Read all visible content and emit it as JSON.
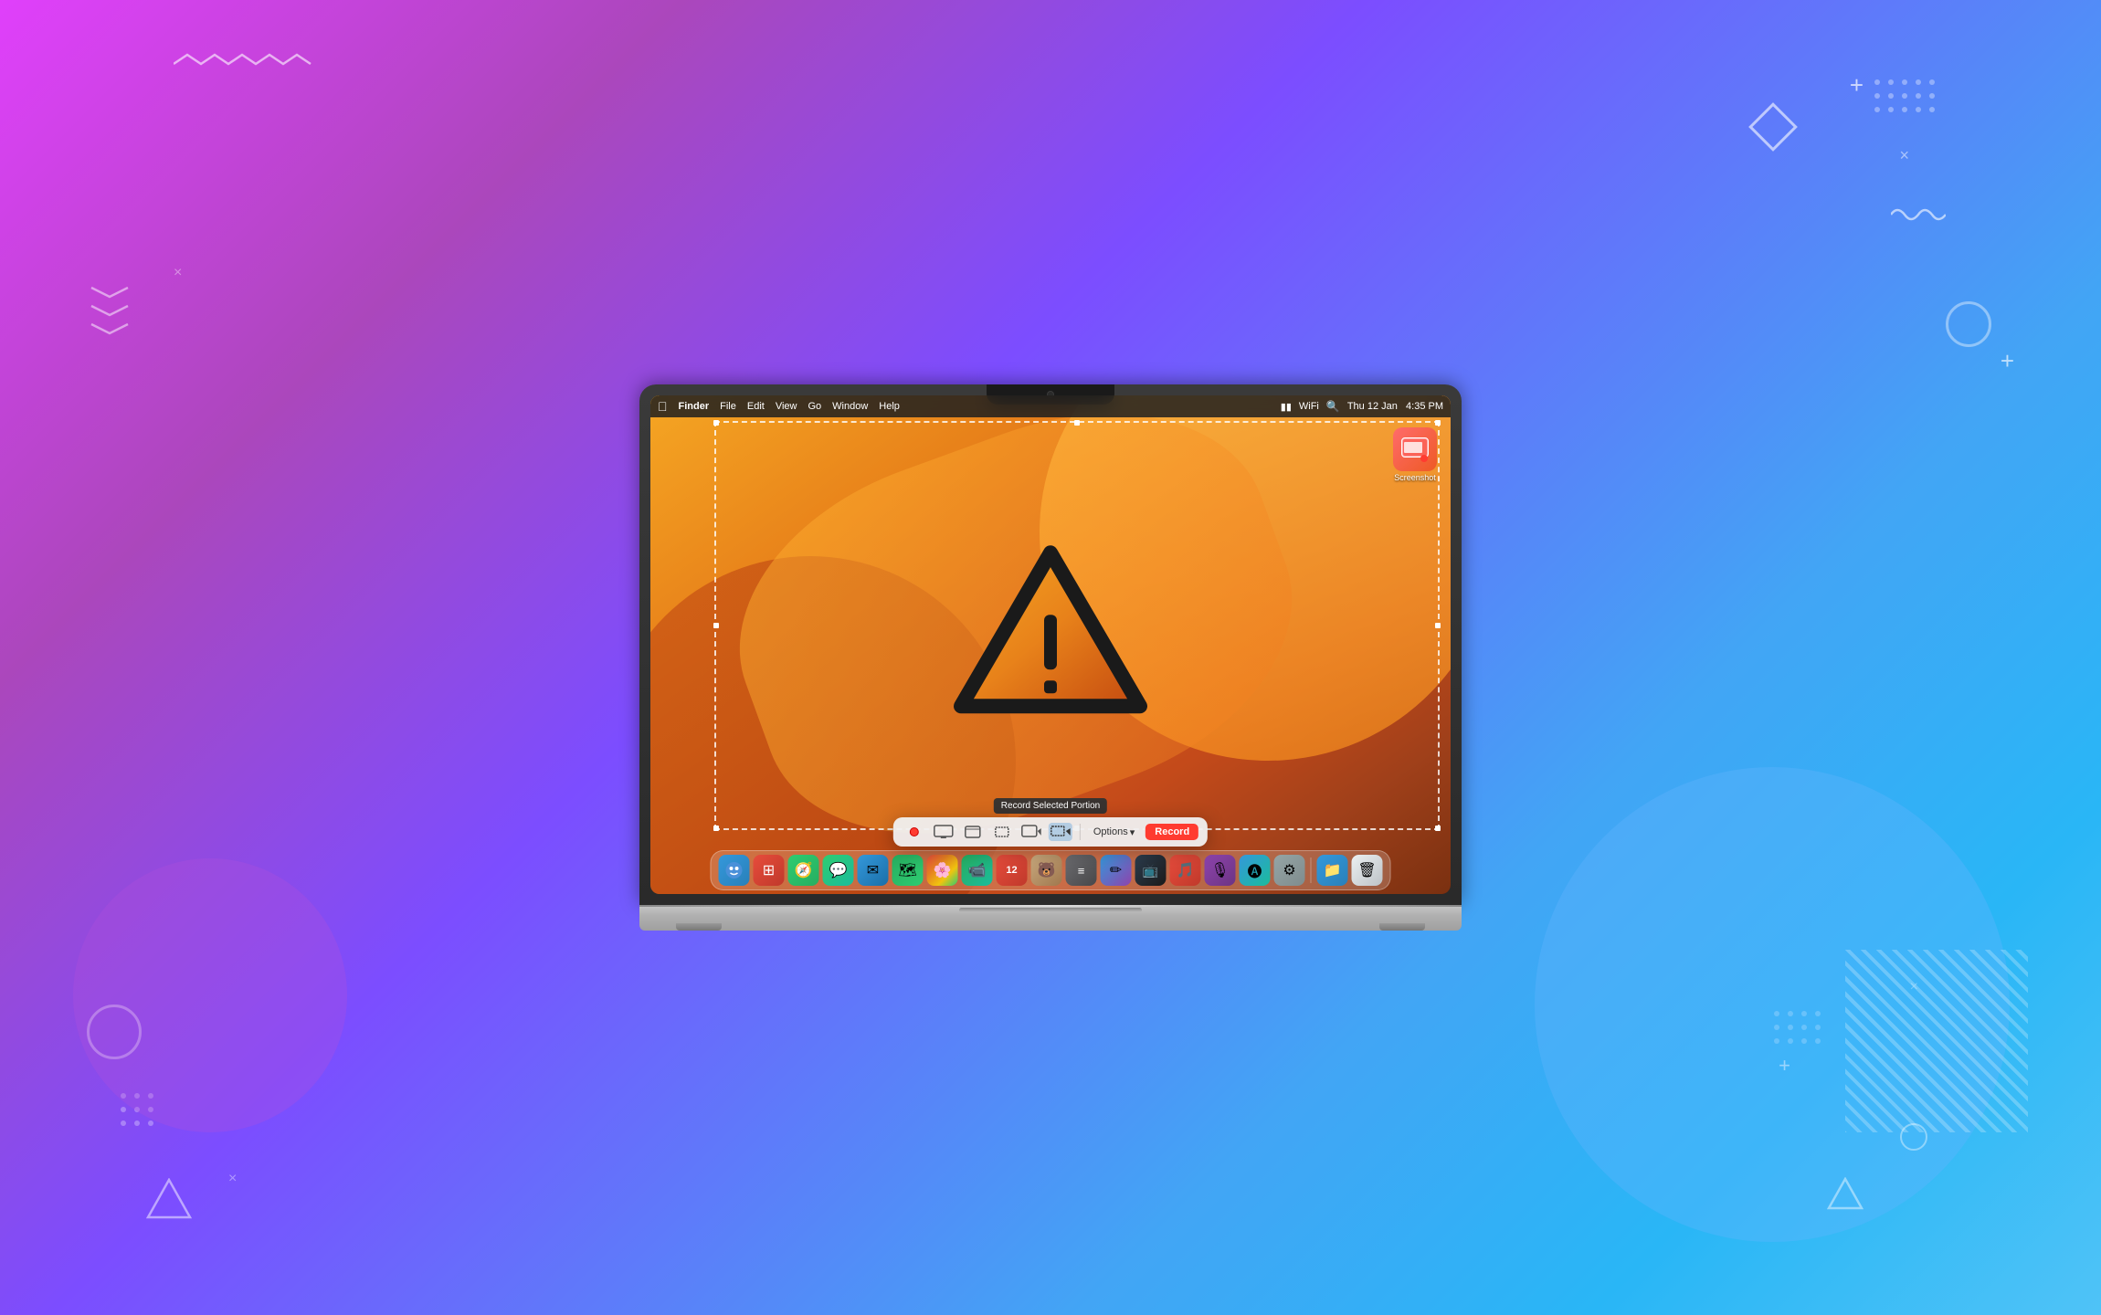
{
  "background": {
    "gradient_start": "#e040fb",
    "gradient_end": "#29b6f6"
  },
  "decorations": {
    "zigzag_top_left": "∿∿∿∿∿",
    "chevrons_left": "⋀\n⋀\n⋀",
    "plus_top_right": "+",
    "plus_mid_right": "+",
    "wavy_right": "〜〜〜",
    "x_marks": [
      "×",
      "×",
      "×",
      "×"
    ],
    "cross_mark": "+"
  },
  "macbook": {
    "screen": {
      "wallpaper": "macOS Ventura orange gradient",
      "menubar": {
        "apple_icon": "⌘",
        "items": [
          "Finder",
          "File",
          "Edit",
          "View",
          "Go",
          "Window",
          "Help"
        ],
        "right_items": [
          "🔋",
          "📶",
          "🔍",
          "Thu 12 Jan",
          "4:35 PM"
        ]
      },
      "desktop_icon": {
        "name": "Screenshot",
        "label": "Screenshot"
      },
      "warning_icon": "⚠",
      "screenshot_selection": {
        "visible": true
      },
      "tooltip": {
        "text": "Record Selected Portion"
      },
      "toolbar": {
        "buttons": [
          {
            "id": "record-dot",
            "icon": "●",
            "label": "Record",
            "type": "dot"
          },
          {
            "id": "capture-screen",
            "icon": "▭",
            "label": "Capture Entire Screen"
          },
          {
            "id": "capture-window",
            "icon": "▭",
            "label": "Capture Selected Window"
          },
          {
            "id": "capture-portion",
            "icon": "▭",
            "label": "Capture Selected Portion"
          },
          {
            "id": "record-screen",
            "icon": "▭",
            "label": "Record Entire Screen"
          },
          {
            "id": "record-portion",
            "icon": "▭",
            "label": "Record Selected Portion",
            "active": true
          }
        ],
        "options_label": "Options",
        "options_chevron": "▾",
        "record_label": "Record"
      },
      "dock": {
        "icons": [
          {
            "id": "finder",
            "emoji": "🔵",
            "label": "Finder",
            "class": "dock-finder"
          },
          {
            "id": "launchpad",
            "emoji": "🔴",
            "label": "Launchpad",
            "class": "dock-launchpad"
          },
          {
            "id": "safari",
            "emoji": "🧭",
            "label": "Safari",
            "class": "dock-safari"
          },
          {
            "id": "messages",
            "emoji": "💬",
            "label": "Messages",
            "class": "dock-messages"
          },
          {
            "id": "mail",
            "emoji": "✉",
            "label": "Mail",
            "class": "dock-mail"
          },
          {
            "id": "maps",
            "emoji": "🗺",
            "label": "Maps",
            "class": "dock-maps"
          },
          {
            "id": "photos",
            "emoji": "🖼",
            "label": "Photos",
            "class": "dock-photos"
          },
          {
            "id": "facetime",
            "emoji": "📹",
            "label": "FaceTime",
            "class": "dock-facetime"
          },
          {
            "id": "calendar",
            "emoji": "📅",
            "label": "Calendar",
            "class": "dock-calendar"
          },
          {
            "id": "bear",
            "emoji": "🐻",
            "label": "Bear",
            "class": "dock-bear"
          },
          {
            "id": "reminders",
            "emoji": "📝",
            "label": "Reminders",
            "class": "dock-reminders"
          },
          {
            "id": "freeform",
            "emoji": "✏",
            "label": "Freeform",
            "class": "dock-freeform"
          },
          {
            "id": "appletv",
            "emoji": "📺",
            "label": "Apple TV",
            "class": "dock-appletv"
          },
          {
            "id": "music",
            "emoji": "🎵",
            "label": "Music",
            "class": "dock-music"
          },
          {
            "id": "podcasts",
            "emoji": "🎙",
            "label": "Podcasts",
            "class": "dock-podcasts"
          },
          {
            "id": "appstore",
            "emoji": "🛍",
            "label": "App Store",
            "class": "dock-appstore"
          },
          {
            "id": "settings",
            "emoji": "⚙",
            "label": "System Settings",
            "class": "dock-settings"
          },
          {
            "id": "files",
            "emoji": "📁",
            "label": "Files",
            "class": "dock-files"
          },
          {
            "id": "trash",
            "emoji": "🗑",
            "label": "Trash",
            "class": "dock-trash"
          }
        ]
      }
    }
  }
}
